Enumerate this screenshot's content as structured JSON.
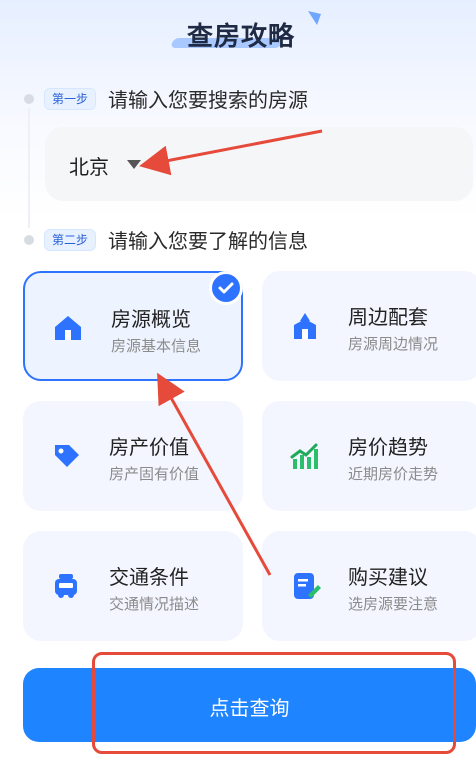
{
  "header": {
    "title": "查房攻略"
  },
  "step1": {
    "badge": "第一步",
    "text": "请输入您要搜索的房源"
  },
  "location": {
    "value": "北京"
  },
  "step2": {
    "badge": "第二步",
    "text": "请输入您要了解的信息"
  },
  "cards": [
    {
      "title": "房源概览",
      "subtitle": "房源基本信息",
      "icon": "house-icon",
      "selected": true
    },
    {
      "title": "周边配套",
      "subtitle": "房源周边情况",
      "icon": "building-icon",
      "selected": false
    },
    {
      "title": "房产价值",
      "subtitle": "房产固有价值",
      "icon": "tag-icon",
      "selected": false
    },
    {
      "title": "房价趋势",
      "subtitle": "近期房价走势",
      "icon": "trend-chart-icon",
      "selected": false
    },
    {
      "title": "交通条件",
      "subtitle": "交通情况描述",
      "icon": "taxi-icon",
      "selected": false
    },
    {
      "title": "购买建议",
      "subtitle": "选房源要注意",
      "icon": "note-edit-icon",
      "selected": false
    }
  ],
  "cta": {
    "label": "点击查询"
  },
  "colors": {
    "accent": "#1f84ff",
    "annotation": "#e54a3a"
  }
}
